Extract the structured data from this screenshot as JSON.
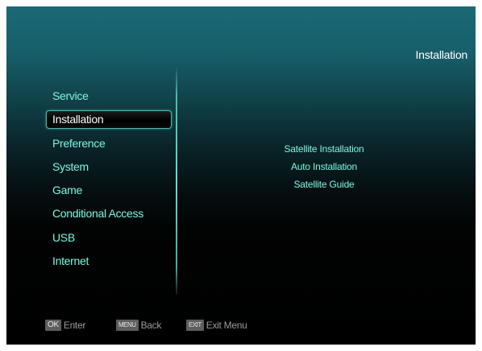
{
  "header": {
    "title": "Installation"
  },
  "main_menu": {
    "items": [
      {
        "label": "Service"
      },
      {
        "label": "Installation",
        "selected": true
      },
      {
        "label": "Preference"
      },
      {
        "label": "System"
      },
      {
        "label": "Game"
      },
      {
        "label": "Conditional Access"
      },
      {
        "label": "USB"
      },
      {
        "label": "Internet"
      }
    ]
  },
  "submenu": {
    "items": [
      {
        "label": "Satellite Installation"
      },
      {
        "label": "Auto Installation"
      },
      {
        "label": "Satellite Guide"
      }
    ]
  },
  "footer": {
    "ok": {
      "key": "OK",
      "label": "Enter"
    },
    "menu": {
      "key": "MENU",
      "label": "Back"
    },
    "exit": {
      "key": "EXIT",
      "label": "Exit Menu"
    }
  },
  "colors": {
    "accent": "#7df5e2",
    "selected_text": "#ffffff",
    "background_top": "#1a6a76",
    "background_bottom": "#000000",
    "hint_text": "#9a9a9a"
  }
}
